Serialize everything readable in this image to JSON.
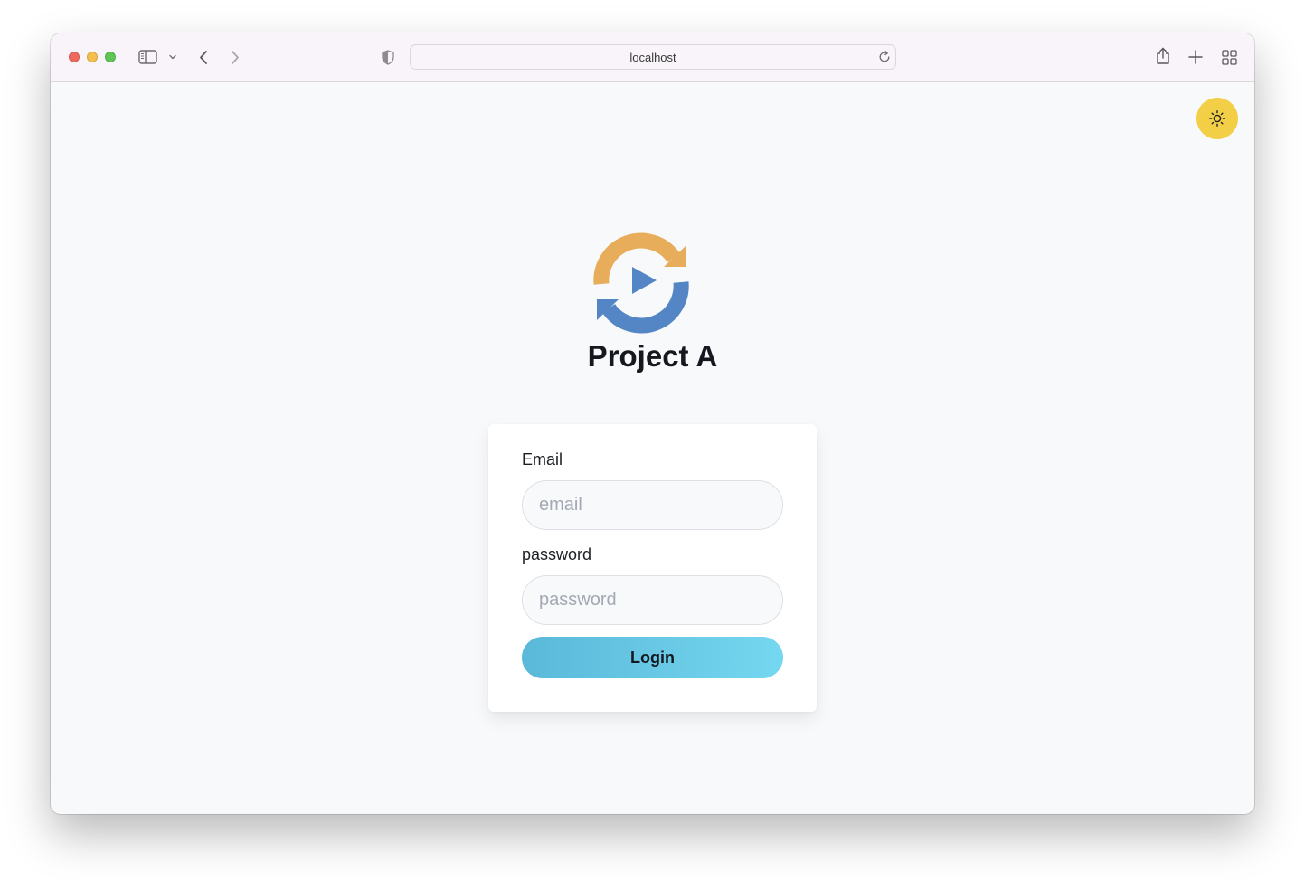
{
  "browser": {
    "url": "localhost",
    "icons": [
      "close-window",
      "minimize-window",
      "zoom-window",
      "sidebar-icon",
      "chevron-down-icon",
      "back-icon",
      "forward-icon",
      "shield-icon",
      "reload-icon",
      "share-icon",
      "new-tab-icon",
      "tab-overview-icon"
    ]
  },
  "theme_toggle": {
    "icon": "sun-icon",
    "color": "#f2cf46"
  },
  "brand": {
    "title": "Project A",
    "logo_icon": "sync-play-logo",
    "logo_colors": {
      "top_arrow": "#e8ad5b",
      "bottom_arrow": "#5486c6",
      "play": "#5486c6"
    }
  },
  "login_form": {
    "email_label": "Email",
    "email_placeholder": "email",
    "email_value": "",
    "password_label": "password",
    "password_placeholder": "password",
    "password_value": "",
    "submit_label": "Login",
    "button_gradient": [
      "#5ab8d9",
      "#75d7f0"
    ]
  }
}
